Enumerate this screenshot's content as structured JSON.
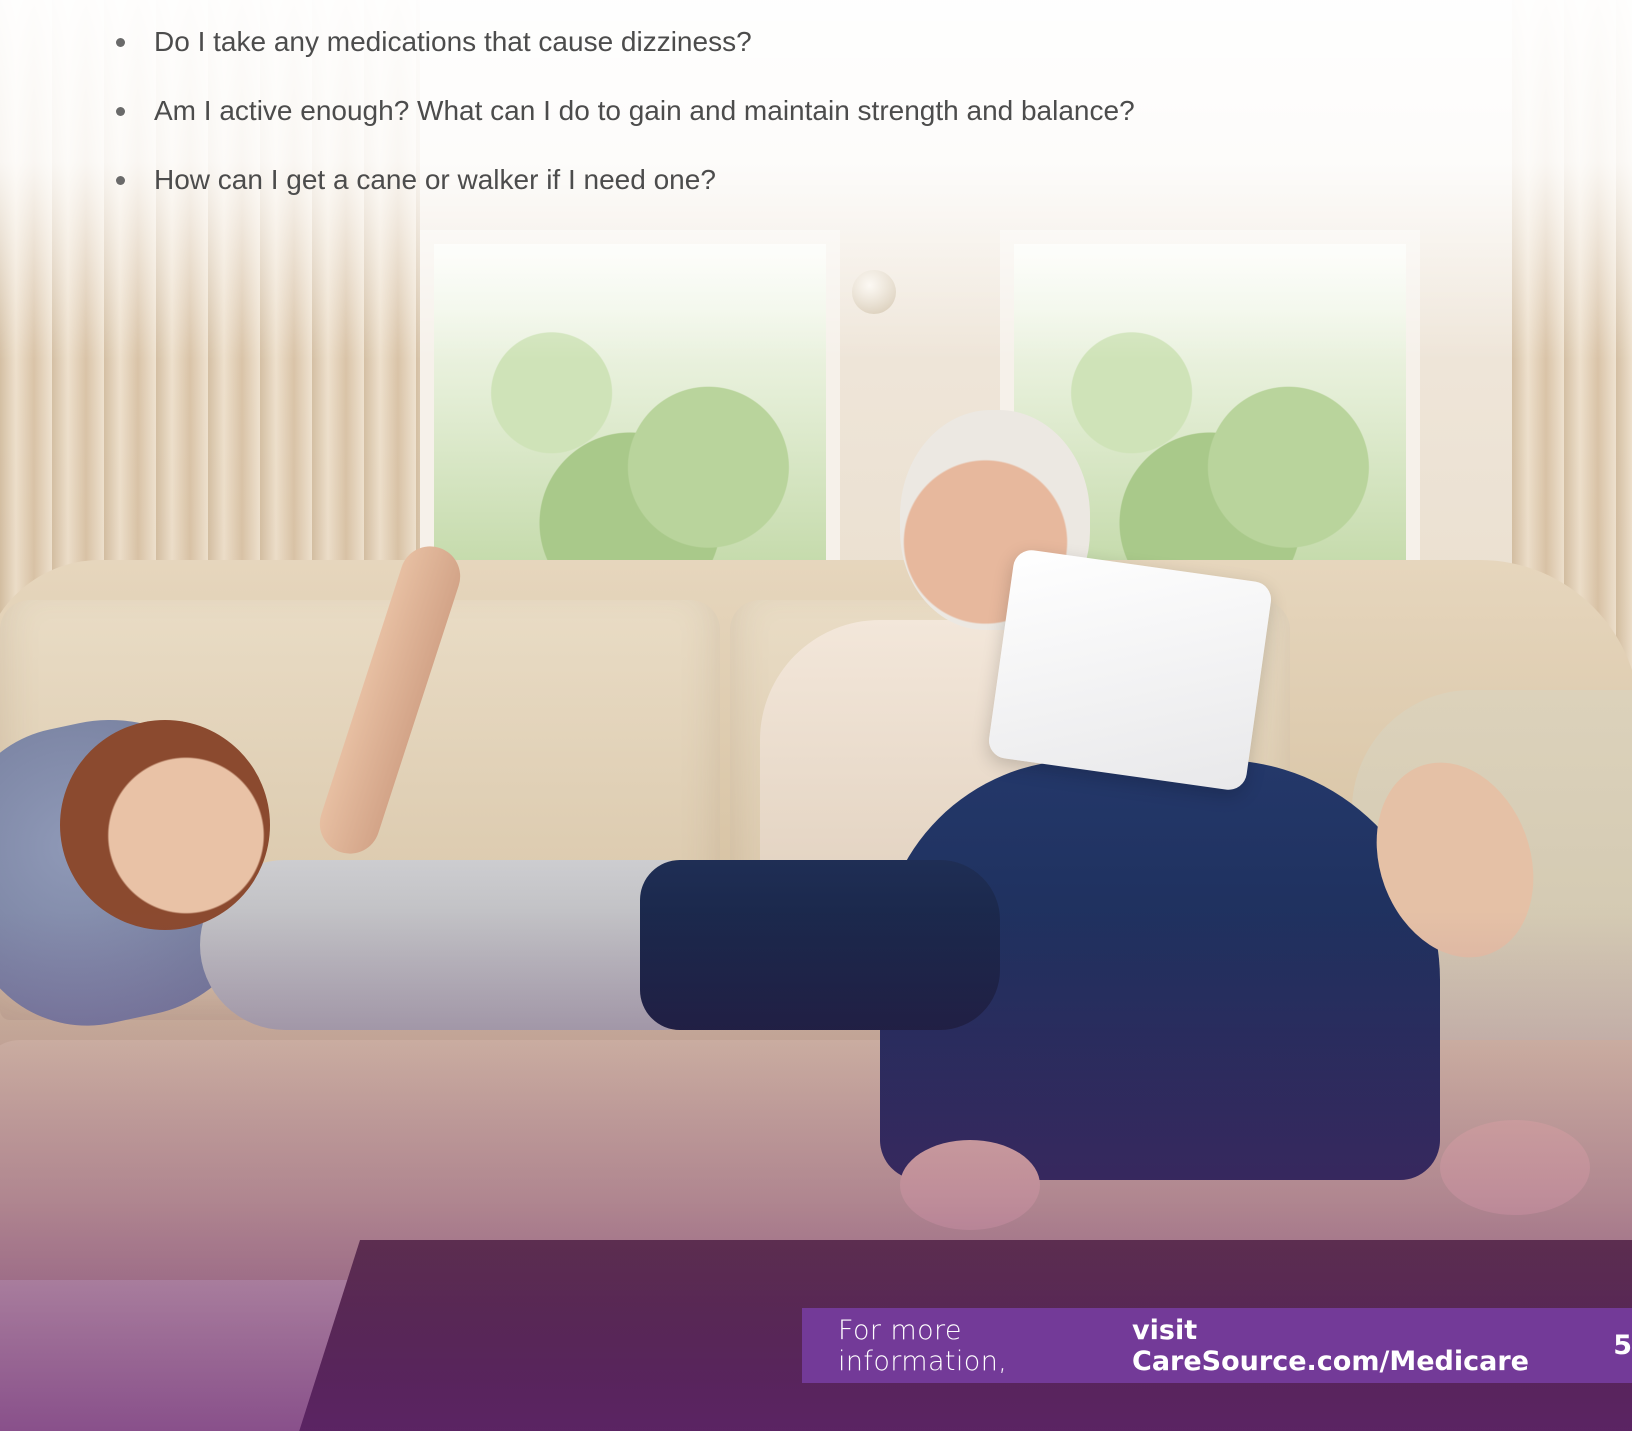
{
  "bullets": [
    "Do I take any medications that cause dizziness?",
    "Am I active enough? What can I do to gain and maintain strength and balance?",
    "How can I get a cane or walker if I need one?"
  ],
  "footer": {
    "lead": "For more information,",
    "link": "visit CareSource.com/Medicare",
    "page_number": "5"
  },
  "colors": {
    "footer_background": "#733a98",
    "body_text": "#4c4c4c"
  }
}
